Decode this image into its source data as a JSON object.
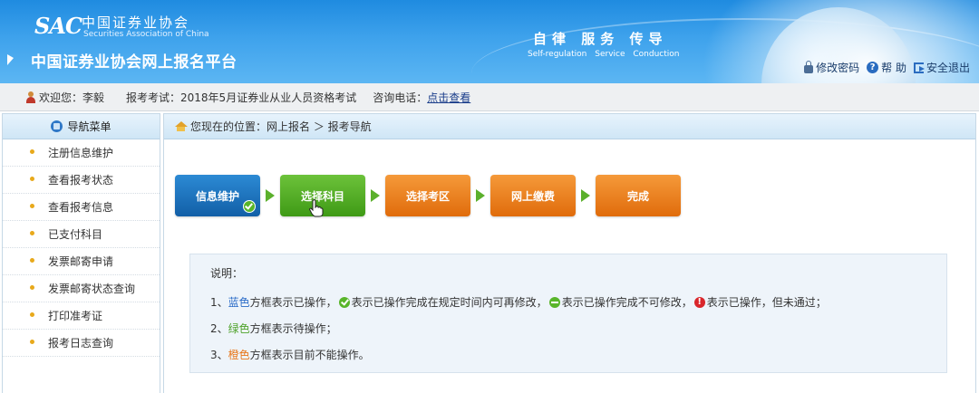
{
  "header": {
    "logo_sac": "SAC",
    "logo_cn": "中国证券业协会",
    "logo_en": "Securities Association of China",
    "site_title": "中国证券业协会网上报名平台",
    "slogan": "自律 服务 传导",
    "slogan_en": "Self-regulation Service Conduction",
    "links": {
      "change_password": "修改密码",
      "help": "帮 助",
      "logout": "安全退出"
    }
  },
  "infobar": {
    "welcome": "欢迎您：李毅",
    "exam": "报考考试：2018年5月证券业从业人员资格考试",
    "phone_label": "咨询电话：",
    "phone_link": "点击查看"
  },
  "sidebar": {
    "title": "导航菜单",
    "items": [
      {
        "label": "注册信息维护"
      },
      {
        "label": "查看报考状态"
      },
      {
        "label": "查看报考信息"
      },
      {
        "label": "已支付科目"
      },
      {
        "label": "发票邮寄申请"
      },
      {
        "label": "发票邮寄状态查询"
      },
      {
        "label": "打印准考证"
      },
      {
        "label": "报考日志查询"
      }
    ]
  },
  "breadcrumb": {
    "text": "您现在的位置：网上报名 ＞ 报考导航"
  },
  "steps": [
    {
      "label": "信息维护",
      "color": "blue",
      "status": "completed"
    },
    {
      "label": "选择科目",
      "color": "green"
    },
    {
      "label": "选择考区",
      "color": "orange"
    },
    {
      "label": "网上缴费",
      "color": "orange"
    },
    {
      "label": "完成",
      "color": "orange"
    }
  ],
  "notes": {
    "title": "说明：",
    "row1": {
      "prefix": "1、",
      "blue": "蓝色",
      "a": "方框表示已操作，",
      "b": "表示已操作完成在规定时间内可再修改，",
      "c": "表示已操作完成不可修改，",
      "d": "表示已操作，但未通过；"
    },
    "row2": {
      "prefix": "2、",
      "green": "绿色",
      "rest": "方框表示待操作；"
    },
    "row3": {
      "prefix": "3、",
      "orange": "橙色",
      "rest": "方框表示目前不能操作。"
    }
  },
  "colors": {
    "header_blue": "#2f95e6",
    "step_blue": "#1f74be",
    "step_green": "#55ad28",
    "step_orange": "#ee8323"
  }
}
